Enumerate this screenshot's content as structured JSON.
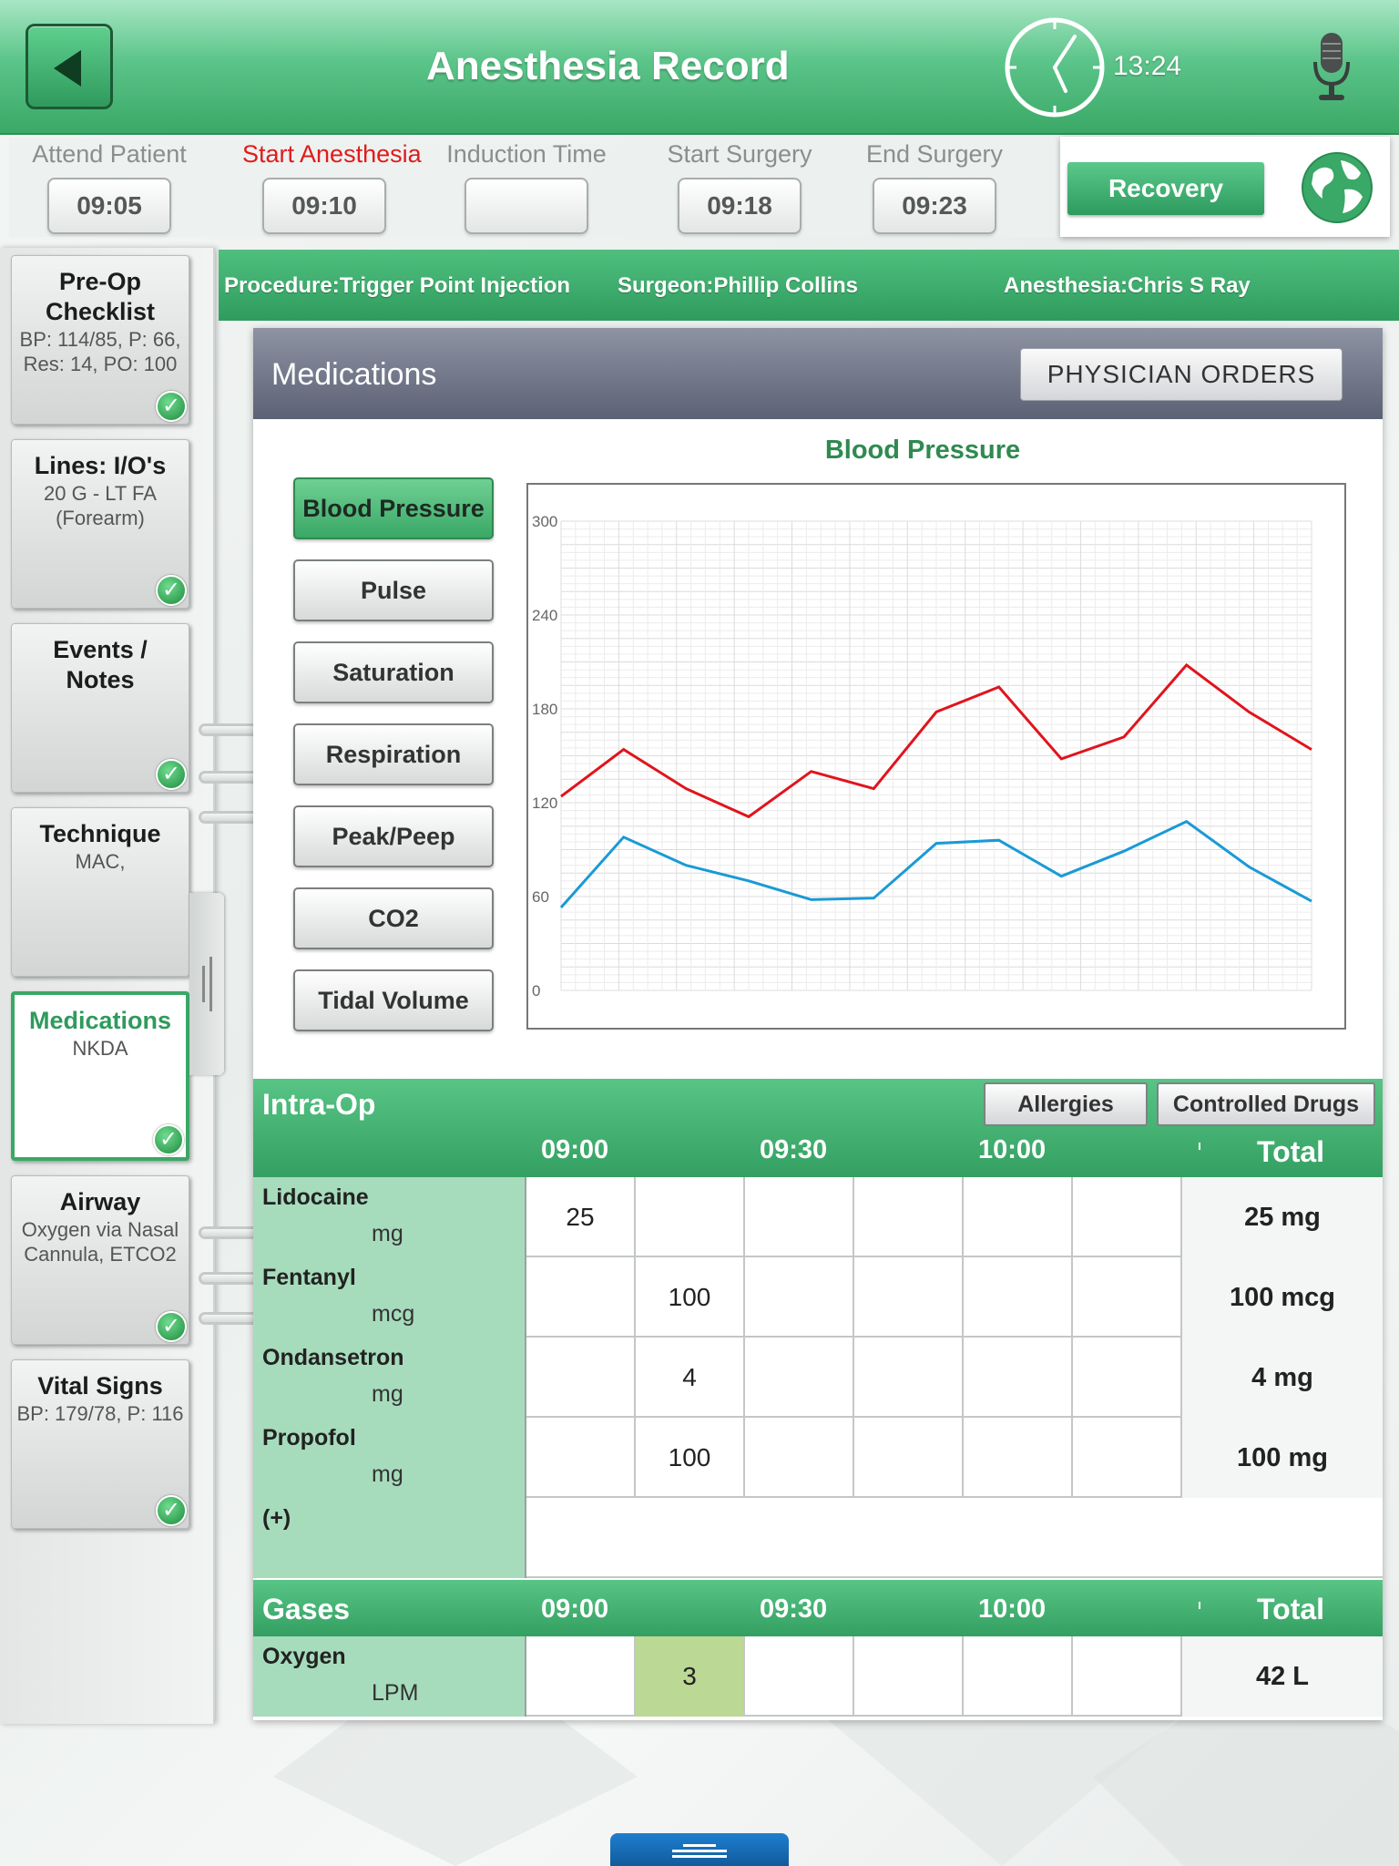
{
  "header": {
    "title": "Anesthesia Record",
    "time": "13:24"
  },
  "timeline": [
    {
      "label": "Attend Patient",
      "value": "09:05",
      "active": false
    },
    {
      "label": "Start Anesthesia",
      "value": "09:10",
      "active": true
    },
    {
      "label": "Induction Time",
      "value": "",
      "active": false
    },
    {
      "label": "Start Surgery",
      "value": "09:18",
      "active": false
    },
    {
      "label": "End Surgery",
      "value": "09:23",
      "active": false
    }
  ],
  "recovery_label": "Recovery",
  "sidebar": [
    {
      "title": "Pre-Op Checklist",
      "sub": "BP: 114/85, P: 66, Res: 14, PO: 100",
      "checked": true
    },
    {
      "title": "Lines: I/O's",
      "sub": "20 G - LT FA (Forearm)",
      "checked": true
    },
    {
      "title": "Events / Notes",
      "sub": "",
      "checked": true
    },
    {
      "title": "Technique",
      "sub": "MAC,",
      "checked": false
    },
    {
      "title": "Medications",
      "sub": "NKDA",
      "checked": true,
      "selected": true
    },
    {
      "title": "Airway",
      "sub": "Oxygen via Nasal Cannula, ETCO2",
      "checked": true
    },
    {
      "title": "Vital Signs",
      "sub": "BP: 179/78, P: 116",
      "checked": true
    }
  ],
  "procedure_bar": {
    "procedure": "Procedure:Trigger Point Injection",
    "surgeon": "Surgeon:Phillip Collins",
    "anesthesia": "Anesthesia:Chris S Ray"
  },
  "panel": {
    "title": "Medications",
    "physician_orders": "PHYSICIAN ORDERS"
  },
  "vital_buttons": [
    "Blood Pressure",
    "Pulse",
    "Saturation",
    "Respiration",
    "Peak/Peep",
    "CO2",
    "Tidal Volume"
  ],
  "chart_data": {
    "type": "line",
    "title": "Blood Pressure",
    "ylim": [
      0,
      300
    ],
    "yticks": [
      0,
      60,
      120,
      180,
      240,
      300
    ],
    "grid": true,
    "series": [
      {
        "color": "#e0141c",
        "values": [
          124,
          154,
          129,
          111,
          140,
          129,
          178,
          194,
          148,
          162,
          208,
          178,
          154
        ]
      },
      {
        "color": "#1a9ad6",
        "values": [
          53,
          98,
          80,
          70,
          58,
          59,
          94,
          96,
          73,
          89,
          108,
          79,
          57
        ]
      }
    ]
  },
  "intraop": {
    "title": "Intra-Op",
    "allergies": "Allergies",
    "controlled": "Controlled Drugs",
    "times": [
      "09:00",
      "09:30",
      "10:00"
    ],
    "total_label": "Total",
    "rows": [
      {
        "name": "Lidocaine",
        "unit": "mg",
        "cells": [
          "25",
          "",
          "",
          "",
          "",
          ""
        ],
        "total": "25 mg"
      },
      {
        "name": "Fentanyl",
        "unit": "mcg",
        "cells": [
          "",
          "100",
          "",
          "",
          "",
          ""
        ],
        "total": "100 mcg"
      },
      {
        "name": "Ondansetron",
        "unit": "mg",
        "cells": [
          "",
          "4",
          "",
          "",
          "",
          ""
        ],
        "total": "4 mg"
      },
      {
        "name": "Propofol",
        "unit": "mg",
        "cells": [
          "",
          "100",
          "",
          "",
          "",
          ""
        ],
        "total": "100 mg"
      }
    ],
    "add_label": "(+)"
  },
  "gases": {
    "title": "Gases",
    "times": [
      "09:00",
      "09:30",
      "10:00"
    ],
    "total_label": "Total",
    "rows": [
      {
        "name": "Oxygen",
        "unit": "LPM",
        "cells": [
          "",
          "3",
          "",
          "",
          "",
          ""
        ],
        "total": "42 L"
      }
    ]
  }
}
